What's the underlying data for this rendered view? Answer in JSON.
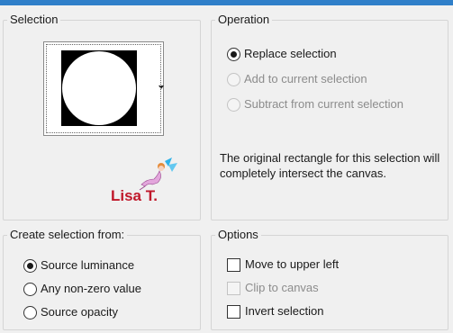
{
  "selection": {
    "title": "Selection",
    "watermark": "Lisa T."
  },
  "operation": {
    "title": "Operation",
    "options": [
      {
        "label": "Replace selection",
        "checked": true,
        "enabled": true
      },
      {
        "label": "Add to current selection",
        "checked": false,
        "enabled": false
      },
      {
        "label": "Subtract from current selection",
        "checked": false,
        "enabled": false
      }
    ],
    "info": "The original rectangle for this selection will completely intersect the canvas."
  },
  "create": {
    "title": "Create selection from:",
    "options": [
      {
        "label": "Source luminance",
        "checked": true
      },
      {
        "label": "Any non-zero value",
        "checked": false
      },
      {
        "label": "Source opacity",
        "checked": false
      }
    ]
  },
  "options": {
    "title": "Options",
    "items": [
      {
        "label": "Move to upper left",
        "checked": false,
        "enabled": true
      },
      {
        "label": "Clip to canvas",
        "checked": false,
        "enabled": false
      },
      {
        "label": "Invert selection",
        "checked": false,
        "enabled": true
      }
    ]
  },
  "colors": {
    "accent": "#2f7fc9",
    "watermark_text": "#c0182a",
    "fairy": "#d878c8"
  }
}
